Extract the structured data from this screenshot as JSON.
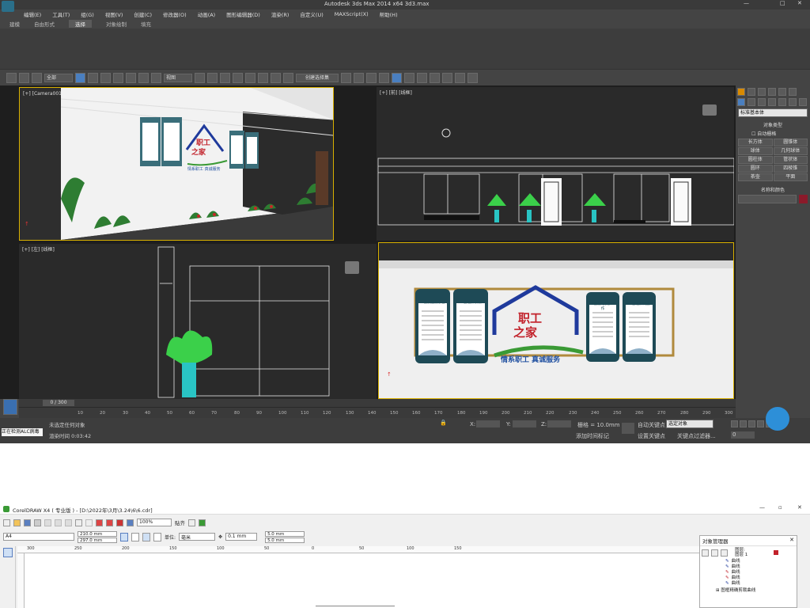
{
  "max": {
    "title": "Autodesk 3ds Max  2014 x64      3d3.max",
    "menu": [
      "编辑(E)",
      "工具(T)",
      "组(G)",
      "视图(V)",
      "创建(C)",
      "修改器(O)",
      "动画(A)",
      "图形编辑器(D)",
      "渲染(R)",
      "自定义(U)",
      "MAXScript(X)",
      "帮助(H)"
    ],
    "ribbon_tabs": [
      "建模",
      "自由形式",
      "选择",
      "对象绘制",
      "填充"
    ],
    "sel_filter": "全部",
    "view_dd": "视图",
    "named_sel": "创建选择集",
    "vp_tl": "[+] [Camera001] [真实]",
    "vp_tr": "[+] [前] [线框]",
    "vp_bl": "[+] [左] [线框]",
    "panel": {
      "dropdown": "标准基本体",
      "rollout1": "对象类型",
      "autogrid": "自动栅格",
      "buttons": [
        "长方体",
        "圆锥体",
        "球体",
        "几何球体",
        "圆柱体",
        "管状体",
        "圆环",
        "四棱锥",
        "茶壶",
        "平面"
      ],
      "rollout2": "名称和颜色",
      "color": "#8b1a2a"
    },
    "wall": {
      "house_text1": "职工",
      "house_text2": "之家",
      "slogan": "情系职工 真诚服务",
      "boards": [
        "工会员服务宗旨",
        "工会组织职权",
        "工会劳动保护工作",
        "工会组织制度"
      ],
      "house_color": "#1f3a9c",
      "text_color": "#c2222b",
      "slogan_color": "#1f4fa0",
      "green": "#3a9a35",
      "gold": "#b08a3c",
      "frame": "#1e4a56"
    },
    "timeline": {
      "slider": "0 / 300",
      "ticks": [
        "10",
        "20",
        "30",
        "40",
        "50",
        "60",
        "70",
        "80",
        "90",
        "100",
        "110",
        "120",
        "130",
        "140",
        "150",
        "160",
        "170",
        "180",
        "190",
        "200",
        "210",
        "220",
        "230",
        "240",
        "250",
        "260",
        "270",
        "280",
        "290",
        "300"
      ]
    },
    "status": {
      "left_top": "正在检测ALC病毒",
      "left_bottom": "",
      "msg1": "未选定任何对象",
      "msg2": "渲染时间 0:03:42",
      "x": "X:",
      "y": "Y:",
      "z": "Z:",
      "grid": "栅格 = 10.0mm",
      "autokey": "自动关键点",
      "setkey": "设置关键点",
      "selected": "选定对象",
      "addmark": "添加时间标记",
      "keyfilter": "关键点过滤器...",
      "frame": "0"
    }
  },
  "cdr": {
    "title": "CorelDRAW X4 ( 专业版 ) - [D:\\2022年\\3月\\3.24\\6\\6.cdr]",
    "zoom": "100%",
    "snap": "贴齐",
    "paper": "A4",
    "w": "210.0 mm",
    "h": "297.0 mm",
    "unit_label": "单位:",
    "unit": "毫米",
    "nudge": "0.1 mm",
    "dx": "5.0 mm",
    "dy": "5.0 mm",
    "ruler": [
      "300",
      "250",
      "200",
      "150",
      "100",
      "50",
      "0",
      "50",
      "100",
      "150"
    ],
    "om_title": "对象管理器",
    "om_layer1": "图层:",
    "om_layer2": "图层 1",
    "om_items": [
      "曲线",
      "曲线",
      "曲线",
      "曲线",
      "曲线"
    ],
    "om_group": "图框精确剪裁曲线"
  }
}
